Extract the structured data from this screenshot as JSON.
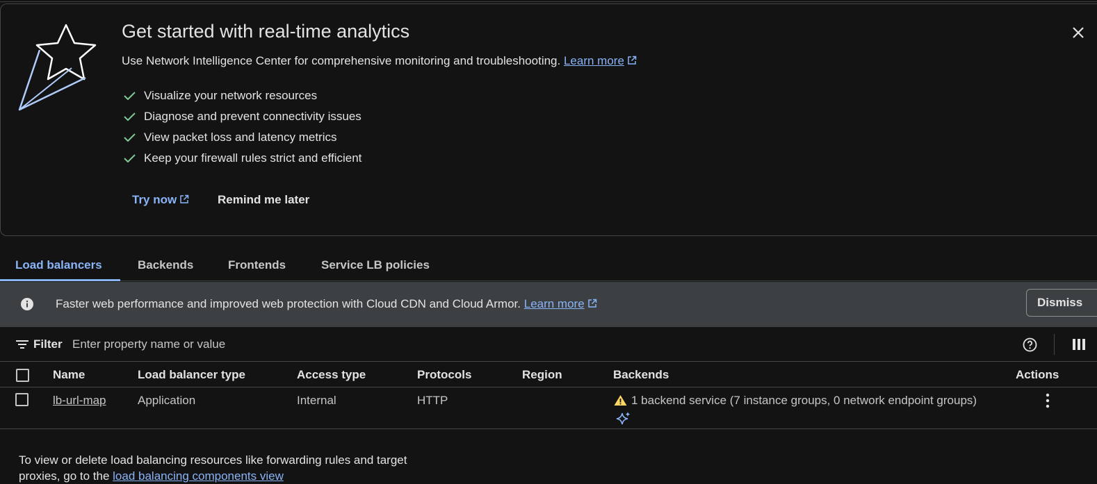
{
  "promo": {
    "title": "Get started with real-time analytics",
    "description": "Use Network Intelligence Center for comprehensive monitoring and troubleshooting.",
    "learn_more": "Learn more",
    "features": [
      "Visualize your network resources",
      "Diagnose and prevent connectivity issues",
      "View packet loss and latency metrics",
      "Keep your firewall rules strict and efficient"
    ],
    "try_now": "Try now",
    "remind_later": "Remind me later"
  },
  "tabs": [
    "Load balancers",
    "Backends",
    "Frontends",
    "Service LB policies"
  ],
  "banner": {
    "text": "Faster web performance and improved web protection with Cloud CDN and Cloud Armor.",
    "learn_more": "Learn more",
    "dismiss": "Dismiss"
  },
  "filter": {
    "label": "Filter",
    "placeholder": "Enter property name or value"
  },
  "table": {
    "headers": [
      "Name",
      "Load balancer type",
      "Access type",
      "Protocols",
      "Region",
      "Backends",
      "Actions"
    ],
    "rows": [
      {
        "name": "lb-url-map",
        "type": "Application",
        "access": "Internal",
        "protocols": "HTTP",
        "region": "",
        "backends": "1 backend service (7 instance groups, 0 network endpoint groups)"
      }
    ]
  },
  "footnote": {
    "text": "To view or delete load balancing resources like forwarding rules and target proxies, go to the",
    "link": "load balancing components view"
  },
  "colors": {
    "background": "#131314",
    "accent": "#8ab4f8",
    "banner_bg": "#3c4043",
    "check_green": "#81c995",
    "warning": "#fdd663"
  }
}
